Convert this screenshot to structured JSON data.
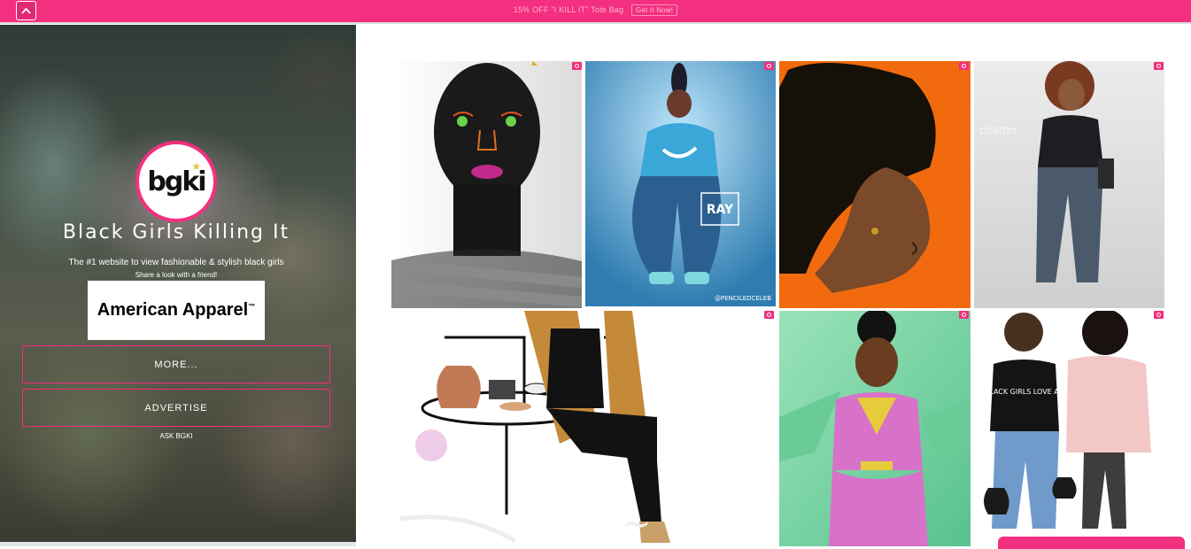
{
  "topbar": {
    "promo_text": "15% OFF \"I KILL IT\" Tote Bag",
    "promo_button": "Get It Now!"
  },
  "sidebar": {
    "logo_text": "bgki",
    "title": "Black Girls Killing It",
    "tagline": "The #1 website to view fashionable & stylish black girls",
    "share": "Share a look with a friend!",
    "ad_text": "American Apparel",
    "ad_tm": "™",
    "more_button": "MORE...",
    "advertise_button": "ADVERTISE",
    "ask_link": "ASK BGKI"
  },
  "gallery": {
    "watermarks": {
      "p2_badge": "RAY",
      "p2_credit": "@PENCILEDCELEB",
      "p4_credit": "chatter",
      "p7_shirt": "BLACK GIRLS LOVE Art"
    }
  },
  "colors": {
    "accent": "#f32f7f",
    "sidebar_text": "#ffffff"
  },
  "icons": [
    "collapse-chevron-icon",
    "camera-icon",
    "star-icon"
  ]
}
